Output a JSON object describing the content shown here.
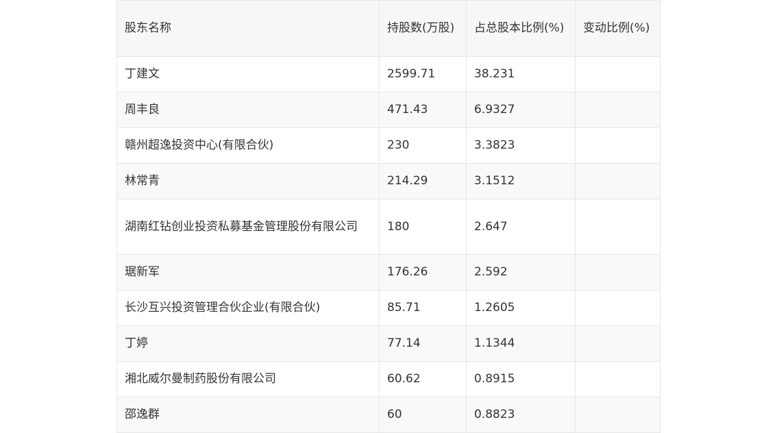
{
  "table": {
    "headers": [
      "股东名称",
      "持股数(万股)",
      "占总股本比例(%)",
      "变动比例(%)"
    ],
    "rows": [
      [
        "丁建文",
        "2599.71",
        "38.231",
        ""
      ],
      [
        "周丰良",
        "471.43",
        "6.9327",
        ""
      ],
      [
        "赣州超逸投资中心(有限合伙)",
        "230",
        "3.3823",
        ""
      ],
      [
        "林常青",
        "214.29",
        "3.1512",
        ""
      ],
      [
        "湖南红钻创业投资私募基金管理股份有限公司",
        "180",
        "2.647",
        ""
      ],
      [
        "琚新军",
        "176.26",
        "2.592",
        ""
      ],
      [
        "长沙互兴投资管理合伙企业(有限合伙)",
        "85.71",
        "1.2605",
        ""
      ],
      [
        "丁婷",
        "77.14",
        "1.1344",
        ""
      ],
      [
        "湘北威尔曼制药股份有限公司",
        "60.62",
        "0.8915",
        ""
      ],
      [
        "邵逸群",
        "60",
        "0.8823",
        ""
      ]
    ]
  }
}
